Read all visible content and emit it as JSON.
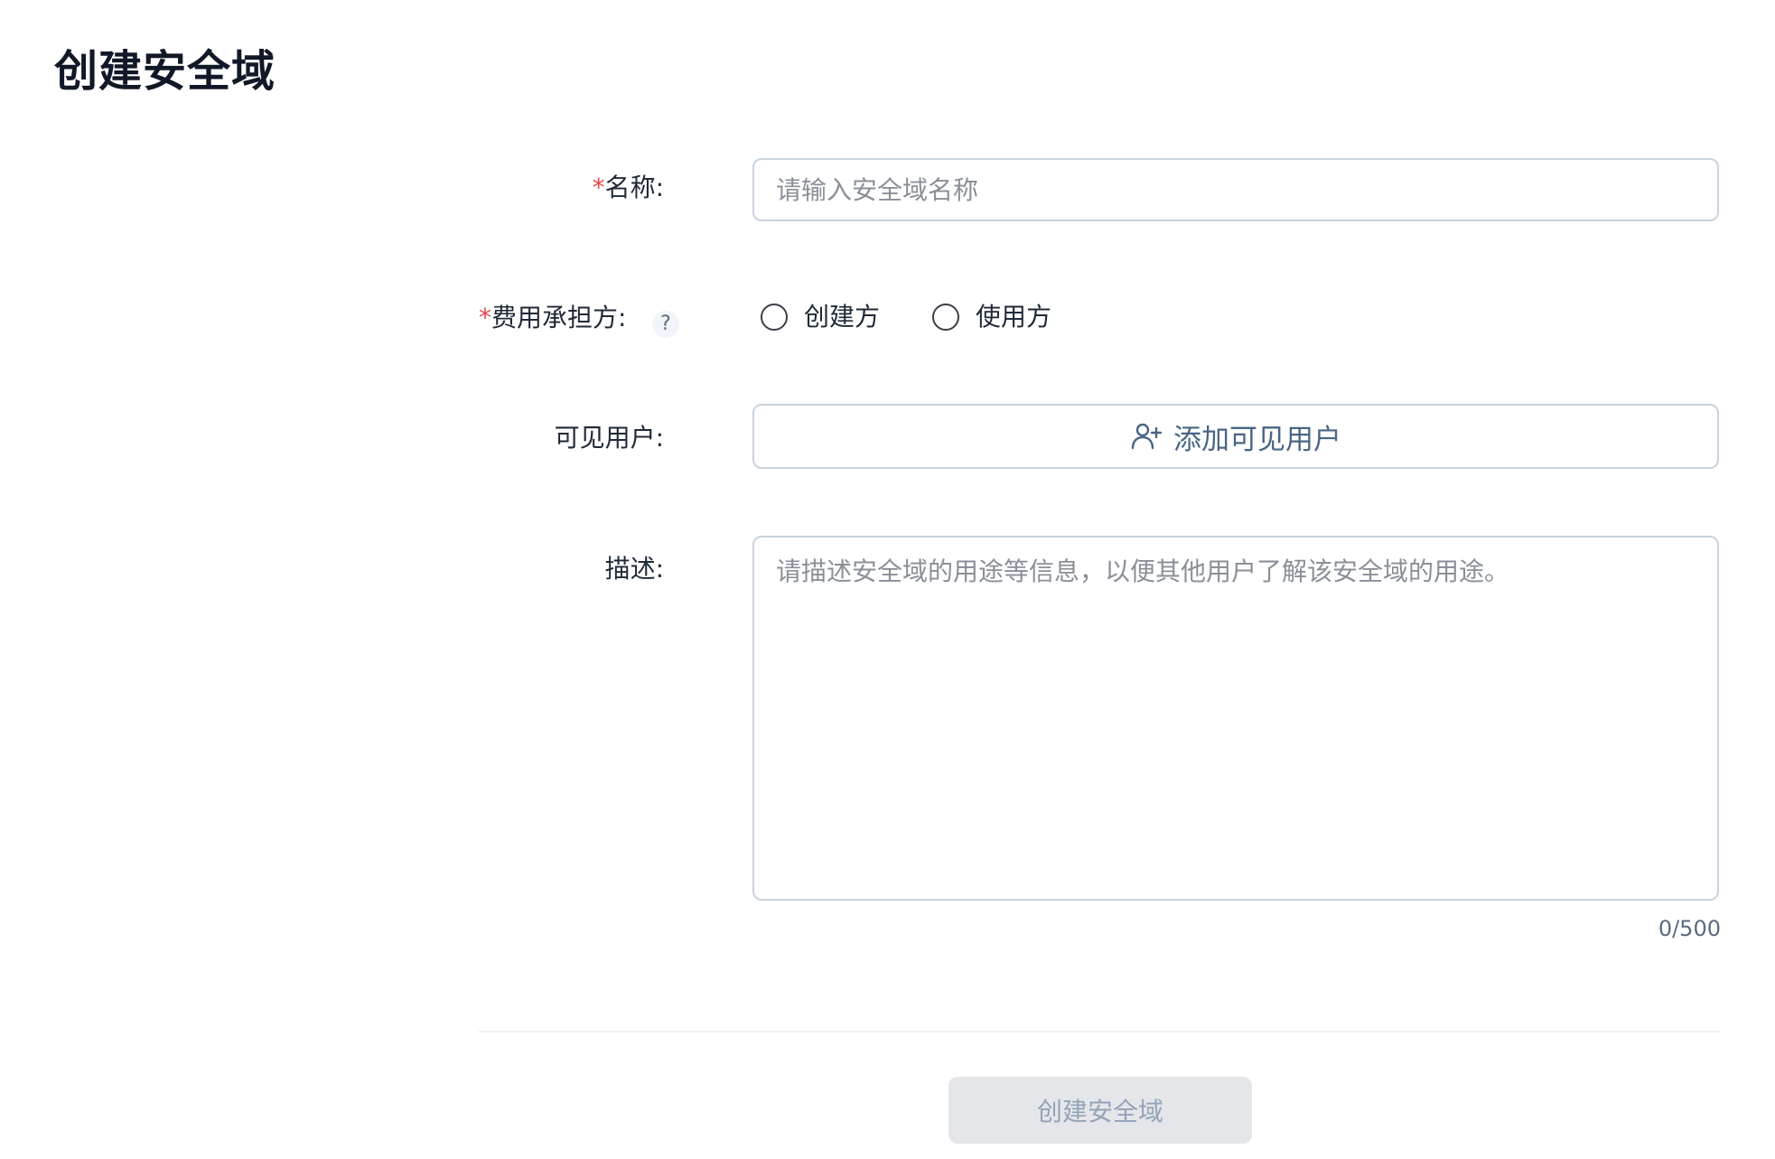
{
  "page": {
    "title": "创建安全域"
  },
  "form": {
    "name": {
      "required_mark": "*",
      "label": "名称:",
      "placeholder": "请输入安全域名称",
      "value": ""
    },
    "cost_bearer": {
      "required_mark": "*",
      "label": "费用承担方:",
      "help_icon": "?",
      "options": [
        {
          "label": "创建方",
          "selected": false
        },
        {
          "label": "使用方",
          "selected": false
        }
      ]
    },
    "visible_users": {
      "label": "可见用户:",
      "button_icon": "add-user-icon",
      "button_label": "添加可见用户"
    },
    "description": {
      "label": "描述:",
      "placeholder": "请描述安全域的用途等信息，以便其他用户了解该安全域的用途。",
      "value": "",
      "counter": "0/500"
    }
  },
  "actions": {
    "submit_label": "创建安全域",
    "submit_disabled": true
  },
  "colors": {
    "required": "#e5484d",
    "border": "#c9d3de",
    "accent_text": "#4a6584",
    "disabled_bg": "#e4e6e9",
    "disabled_text": "#94a3b8"
  }
}
